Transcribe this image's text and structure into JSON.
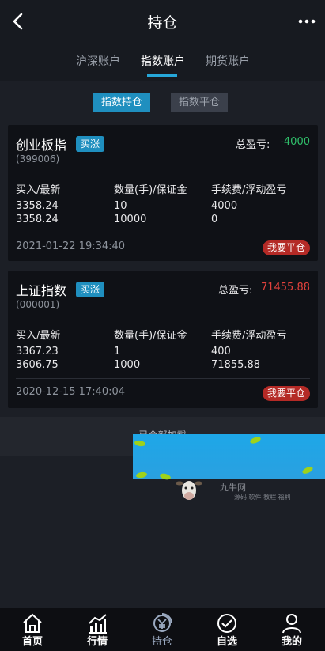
{
  "header": {
    "title": "持仓"
  },
  "tabs": [
    {
      "label": "沪深账户"
    },
    {
      "label": "指数账户"
    },
    {
      "label": "期货账户"
    }
  ],
  "subtabs": [
    {
      "label": "指数持仓"
    },
    {
      "label": "指数平仓"
    }
  ],
  "positions": [
    {
      "name": "创业板指",
      "badge": "买涨",
      "code": "(399006)",
      "pl_label": "总盈亏:",
      "pl_value": "-4000",
      "col1_header": "买入/最新",
      "col2_header": "数量(手)/保证金",
      "col3_header": "手续费/浮动盈亏",
      "buy_price": "3358.24",
      "latest_price": "3358.24",
      "quantity": "10",
      "margin": "10000",
      "fee": "4000",
      "floating_pl": "0",
      "time": "2021-01-22 19:34:40",
      "close_label": "我要平仓"
    },
    {
      "name": "上证指数",
      "badge": "买涨",
      "code": "(000001)",
      "pl_label": "总盈亏:",
      "pl_value": "71455.88",
      "col1_header": "买入/最新",
      "col2_header": "数量(手)/保证金",
      "col3_header": "手续费/浮动盈亏",
      "buy_price": "3367.23",
      "latest_price": "3606.75",
      "quantity": "1",
      "margin": "1000",
      "fee": "400",
      "floating_pl": "71855.88",
      "time": "2020-12-15 17:40:04",
      "close_label": "我要平仓"
    }
  ],
  "load_status": "已全部加载",
  "watermark": {
    "title": "九牛网",
    "subtitle": "源码 软件 教程 福利"
  },
  "bottom_nav": [
    {
      "label": "首页",
      "icon": "home-icon"
    },
    {
      "label": "行情",
      "icon": "chart-icon"
    },
    {
      "label": "持仓",
      "icon": "position-icon"
    },
    {
      "label": "自选",
      "icon": "check-circle-icon"
    },
    {
      "label": "我的",
      "icon": "user-icon"
    }
  ],
  "colors": {
    "accent": "#1f8fbf",
    "profit_red": "#e0413c",
    "loss_green": "#2fbf6a"
  }
}
